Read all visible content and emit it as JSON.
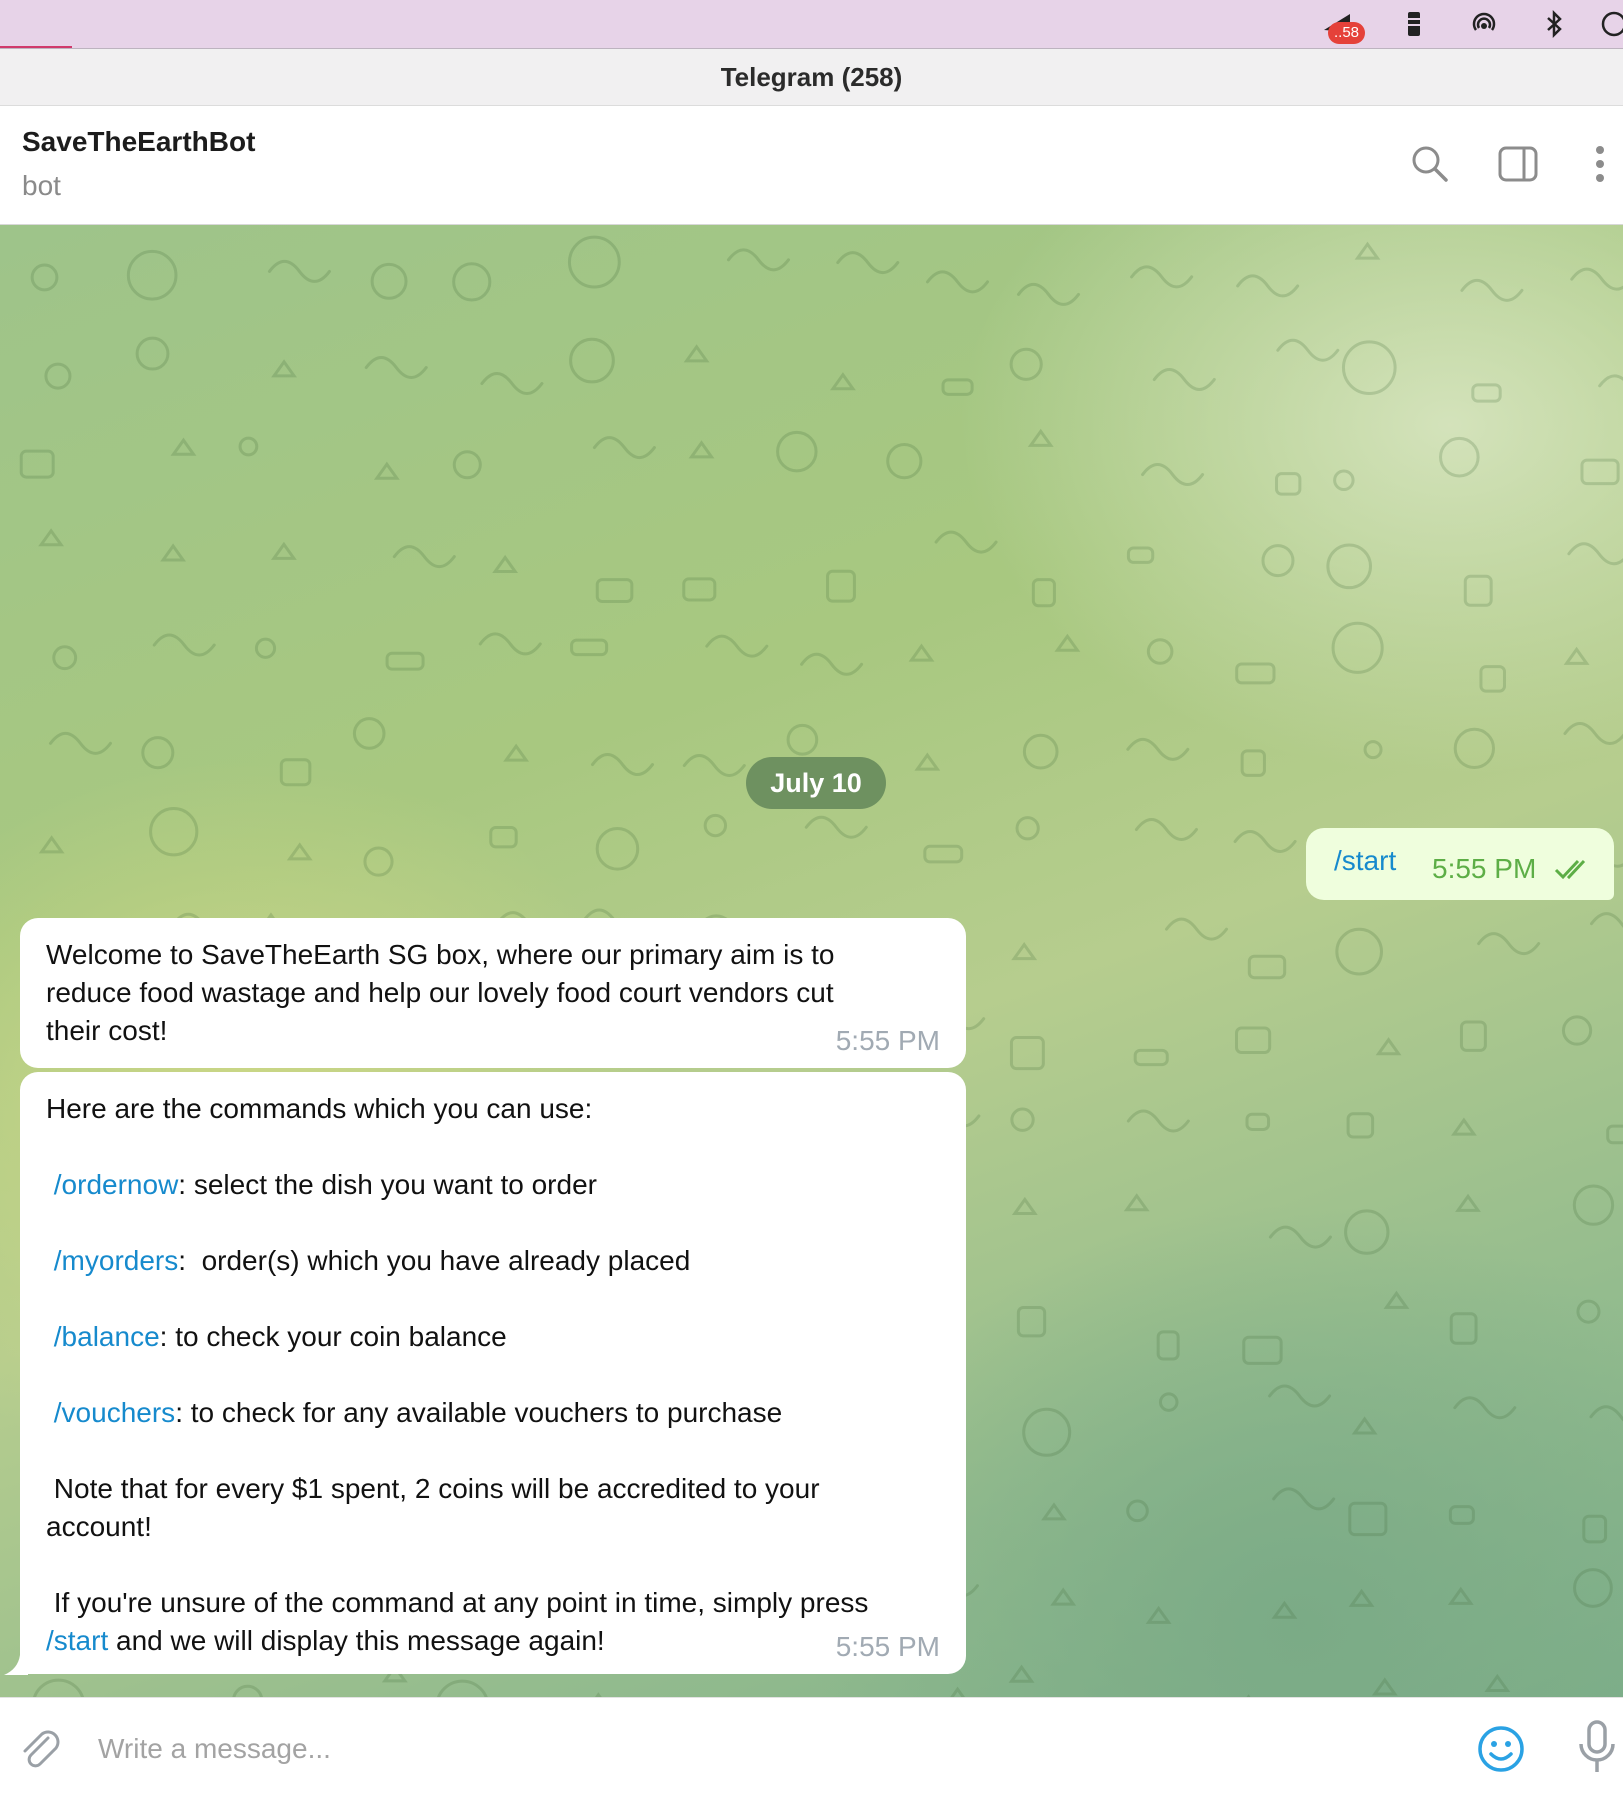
{
  "menubar": {
    "badge": "..58",
    "icons": [
      "battery-alert-icon",
      "tower-icon",
      "airdrop-icon",
      "bluetooth-icon",
      "clock-icon"
    ]
  },
  "window": {
    "title": "Telegram (258)"
  },
  "chat": {
    "name": "SaveTheEarthBot",
    "status": "bot",
    "actions": [
      "search-icon",
      "sidebar-toggle-icon",
      "more-vertical-icon"
    ]
  },
  "date_separator": "July 10",
  "messages": {
    "outgoing": {
      "text": "/start",
      "time": "5:55 PM",
      "status": "read"
    },
    "welcome": {
      "lines": [
        "Welcome to SaveTheEarth SG box, where our primary aim is to",
        "reduce food wastage and help our lovely food court vendors cut",
        "their cost!"
      ],
      "time": "5:55 PM"
    },
    "commands": {
      "intro": "Here are the commands which you can use:",
      "items": [
        {
          "command": "/ordernow",
          "description": ": select the dish you want to order"
        },
        {
          "command": "/myorders",
          "description": ":  order(s) which you have already placed"
        },
        {
          "command": "/balance",
          "description": ": to check your coin balance"
        },
        {
          "command": "/vouchers",
          "description": ": to check for any available vouchers to purchase"
        }
      ],
      "note_line1": " Note that for every $1 spent, 2 coins will be accredited to your",
      "note_line2": "account!",
      "help_line1": " If you're unsure of the command at any point in time, simply press",
      "help_command": "/start",
      "help_line2": " and we will display this message again!",
      "time": "5:55 PM"
    }
  },
  "composer": {
    "placeholder": "Write a message..."
  },
  "colors": {
    "link": "#168acd",
    "outgoing_bubble": "#effedd",
    "outgoing_time": "#5dae46",
    "incoming_time": "#a1aab3",
    "date_pill": "#5c8256",
    "emoji_button": "#2aa2e4"
  }
}
